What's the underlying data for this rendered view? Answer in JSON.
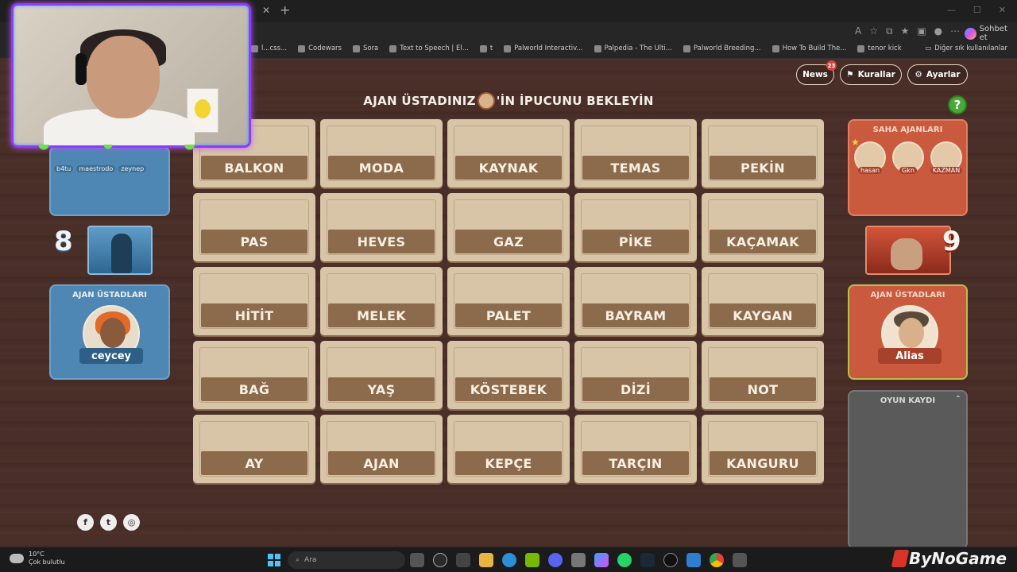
{
  "browser": {
    "copilot_label": "Sohbet et",
    "bookmarks": [
      {
        "label": "l...css..."
      },
      {
        "label": "Codewars"
      },
      {
        "label": "Sora"
      },
      {
        "label": "Text to Speech | El..."
      },
      {
        "label": "t"
      },
      {
        "label": "Palworld Interactiv..."
      },
      {
        "label": "Palpedia - The Ulti..."
      },
      {
        "label": "Palworld Breeding..."
      },
      {
        "label": "How To Build The..."
      },
      {
        "label": "tenor kick"
      }
    ],
    "other_bookmarks": "Diğer sık kullanılanlar"
  },
  "header": {
    "news_label": "News",
    "news_count": "23",
    "rules_label": "Kurallar",
    "settings_label": "Ayarlar",
    "title_prefix": "AJAN ÜSTADINIZ",
    "title_suffix": "'İN İPUCUNU BEKLEYİN",
    "title_avatar_name": "Alias",
    "help_label": "?"
  },
  "cards": [
    [
      "BALKON",
      "MODA",
      "KAYNAK",
      "TEMAS",
      "PEKİN"
    ],
    [
      "PAS",
      "HEVES",
      "GAZ",
      "PİKE",
      "KAÇAMAK"
    ],
    [
      "HİTİT",
      "MELEK",
      "PALET",
      "BAYRAM",
      "KAYGAN"
    ],
    [
      "BAĞ",
      "YAŞ",
      "KÖSTEBEK",
      "DİZİ",
      "NOT"
    ],
    [
      "AY",
      "AJAN",
      "KEPÇE",
      "TARÇIN",
      "KANGURU"
    ]
  ],
  "blue_team": {
    "operatives": [
      "b4tu",
      "maestrodo",
      "zeynep"
    ],
    "score": "8",
    "masters_label": "AJAN ÜSTADLARI",
    "master_name": "ceycey",
    "colors": {
      "panel": "#4e87b4"
    }
  },
  "red_team": {
    "operatives_label": "SAHA AJANLARI",
    "operatives": [
      "hasan",
      "Gkn",
      "KAZMAN"
    ],
    "score": "9",
    "masters_label": "AJAN ÜSTADLARI",
    "master_name": "Alias",
    "colors": {
      "panel": "#c95a3e"
    }
  },
  "log": {
    "label": "OYUN KAYDI"
  },
  "socials": [
    "facebook-icon",
    "twitter-icon",
    "instagram-icon"
  ],
  "taskbar": {
    "temperature": "10°C",
    "condition": "Çok bulutlu",
    "search_placeholder": "Ara",
    "brand": "ByNoGame"
  }
}
